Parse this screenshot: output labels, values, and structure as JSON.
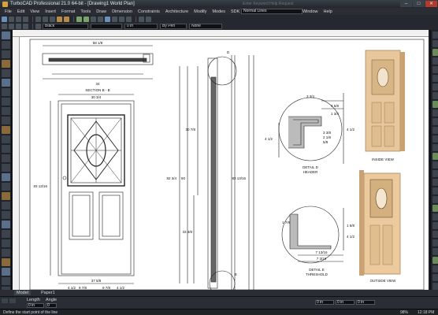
{
  "window": {
    "title": "TurboCAD Professional 21.0 64-bit - [Drawing1 World Plan]",
    "ghost_text": "Enter Keyword Help Request",
    "min": "–",
    "max": "□",
    "close": "✕"
  },
  "menu": [
    "File",
    "Edit",
    "View",
    "Insert",
    "Format",
    "Tools",
    "Draw",
    "Dimension",
    "Constraints",
    "Architecture",
    "Modify",
    "Modes",
    "SDK",
    "AddOns",
    "Ruby",
    "Options",
    "Window",
    "Help"
  ],
  "line_style_combo": "Normal Lines",
  "property_bar": {
    "pen_color": "Black",
    "line_width": "0 in",
    "pen_style": "By Pen",
    "fill": "None"
  },
  "drawing": {
    "top_dims": [
      "58 1/8",
      "34"
    ],
    "section_label": "SECTION B - B",
    "door_top_dim": "30 3/4",
    "door_height_dim": "83 13/16",
    "door_bottom_dims": [
      "37 5/8",
      "4 1/2",
      "4 1/2",
      "9 7/8",
      "9 7/8"
    ],
    "side_dims": [
      "82 3/4",
      "60",
      "30 7/8",
      "33 3/8",
      "83 13/16"
    ],
    "detail_d": {
      "label": "DETAIL D",
      "sub": "HEADER",
      "dims": [
        "3 3/4",
        "4 5/8",
        "1 3/4",
        "4 1/2",
        "3 3/8",
        "2 1/8",
        "5/8",
        "4 1/2"
      ]
    },
    "detail_e": {
      "label": "DETAIL E",
      "sub": "THRESHOLD",
      "dims": [
        "1 7/8",
        "7 13/16",
        "7 3/16",
        "1 5/8",
        "4 1/2"
      ]
    },
    "inside_view": "INSIDE VIEW",
    "outside_view": "OUTSIDE VIEW",
    "markers": [
      "D",
      "E"
    ]
  },
  "tabs": [
    "Model",
    "Paper1"
  ],
  "tool_row": {
    "length_label": "Length",
    "angle_label": "Angle",
    "length_value": "0 in",
    "angle_value": "0"
  },
  "statusbar": {
    "prompt": "Define the start point of the line",
    "coords": [
      "0 in",
      "0 in",
      "0 in"
    ],
    "zoom": "98%",
    "clock": "12:18 PM"
  }
}
